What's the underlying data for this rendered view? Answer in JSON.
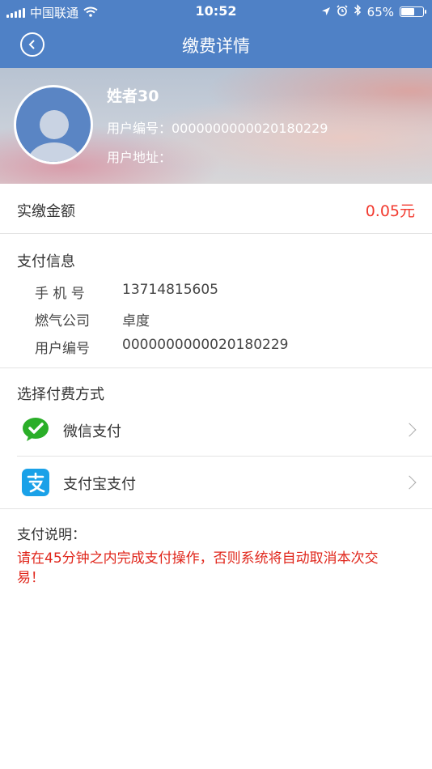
{
  "status_bar": {
    "carrier": "中国联通",
    "time": "10:52",
    "battery_text": "65%",
    "battery_level": 0.65
  },
  "nav": {
    "title": "缴费详情"
  },
  "user": {
    "name": "姓者30",
    "id_line": "用户编号：0000000000020180229",
    "address_line": "用户地址："
  },
  "amount": {
    "label": "实缴金额",
    "value": "0.05元"
  },
  "payment_info": {
    "title": "支付信息",
    "rows": [
      {
        "label": "手 机 号",
        "value": "13714815605"
      },
      {
        "label": "燃气公司",
        "value": "卓度"
      },
      {
        "label": "用户编号",
        "value": "0000000000020180229"
      }
    ]
  },
  "payment_methods": {
    "title": "选择付费方式",
    "items": [
      {
        "label": "微信支付",
        "icon": "wechat-pay-icon",
        "color": "#2aae28"
      },
      {
        "label": "支付宝支付",
        "icon": "alipay-icon",
        "color": "#1aa1e8"
      }
    ]
  },
  "notes": {
    "title": "支付说明：",
    "text": "请在45分钟之内完成支付操作，否则系统将自动取消本次交易！"
  },
  "colors": {
    "nav_bg": "#4f81c6",
    "amount": "#f23a2f",
    "warning": "#e0261b"
  }
}
